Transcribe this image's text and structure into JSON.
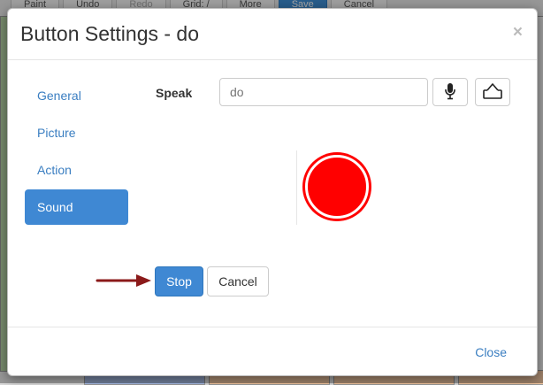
{
  "background": {
    "toolbar": [
      {
        "label": "Paint",
        "style": ""
      },
      {
        "label": "Undo",
        "style": ""
      },
      {
        "label": "Redo",
        "style": "muted"
      },
      {
        "label": "Grid: /",
        "style": ""
      },
      {
        "label": "More",
        "style": ""
      },
      {
        "label": "Save",
        "style": "primary"
      },
      {
        "label": "Cancel",
        "style": ""
      }
    ]
  },
  "modal": {
    "title": "Button Settings - do",
    "close_symbol": "×",
    "nav": [
      {
        "label": "General",
        "active": false
      },
      {
        "label": "Picture",
        "active": false
      },
      {
        "label": "Action",
        "active": false
      },
      {
        "label": "Sound",
        "active": true
      }
    ],
    "speak_label": "Speak",
    "speak_placeholder": "do",
    "mic_icon": "microphone-icon",
    "upload_icon": "upload-icon",
    "record_icon": "record-icon",
    "record_color": "#ff0000",
    "stop_label": "Stop",
    "cancel_label": "Cancel",
    "footer_close_label": "Close",
    "accent_color": "#3f88d3",
    "arrow_color": "#8b1a1a"
  }
}
